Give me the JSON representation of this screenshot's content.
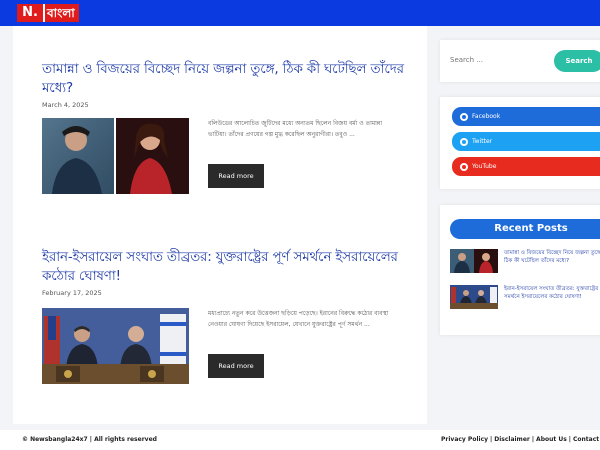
{
  "header": {
    "logo_letter": "N.",
    "logo_text": "বাংলা",
    "bar_color": "#0b3be0",
    "logo_color": "#e01b1b"
  },
  "posts": [
    {
      "title": "তামান্না ও বিজয়ের বিচ্ছেদ নিয়ে জল্পনা তুঙ্গে, ঠিক কী ঘটেছিল তাঁদের মধ্যে?",
      "date": "March 4, 2025",
      "excerpt": "বলিউডের আলোচিত জুটিদের মধ্যে অন্যতম ছিলেন বিজয় বর্মা ও তামান্না ভাটিয়া। তাঁদের প্রণয়ের গল্প মুগ্ধ করেছিল অনুরাগীরা। তবুও ...",
      "read_more": "Read more",
      "image_alt": "তামান্না ও বিজয়"
    },
    {
      "title": "ইরান-ইসরায়েল সংঘাত তীব্রতর: যুক্তরাষ্ট্রের পূর্ণ সমর্থনে ইসরায়েলের কঠোর ঘোষণা!",
      "date": "February 17, 2025",
      "excerpt": "মধ্যপ্রাচ্যে নতুন করে উত্তেজনা ছড়িয়ে পড়েছে। ইরানের বিরুদ্ধে কঠোর ব্যবস্থা নেওয়ার ঘোষণা দিয়েছে ইসরায়েল, যেখানে যুক্তরাষ্ট্রের পূর্ণ সমর্থন ...",
      "read_more": "Read more",
      "image_alt": "ইরান-ইসরায়েল"
    }
  ],
  "sidebar": {
    "search": {
      "placeholder": "Search ...",
      "button_label": "Search"
    },
    "social": [
      {
        "label": "Facebook",
        "icon": "facebook-icon",
        "color": "#1d6cd9"
      },
      {
        "label": "Twitter",
        "icon": "twitter-icon",
        "color": "#1da1f2"
      },
      {
        "label": "YouTube",
        "icon": "youtube-icon",
        "color": "#e82b1f"
      }
    ],
    "recent": {
      "heading": "Recent Posts",
      "items": [
        {
          "title": "তামান্না ও বিজয়ের বিচ্ছেদ নিয়ে জল্পনা তুঙ্গে, ঠিক কী ঘটেছিল তাঁদের মধ্যে?"
        },
        {
          "title": "ইরান-ইসরায়েল সংঘাত তীব্রতর: যুক্তরাষ্ট্রের পূর্ণ সমর্থনে ইসরায়েলের কঠোর ঘোষণা!"
        }
      ]
    }
  },
  "footer": {
    "copyright": "© Newsbangla24x7 | All rights reserved",
    "links": [
      "Privacy Policy",
      "Disclaimer",
      "About Us",
      "Contact"
    ]
  }
}
